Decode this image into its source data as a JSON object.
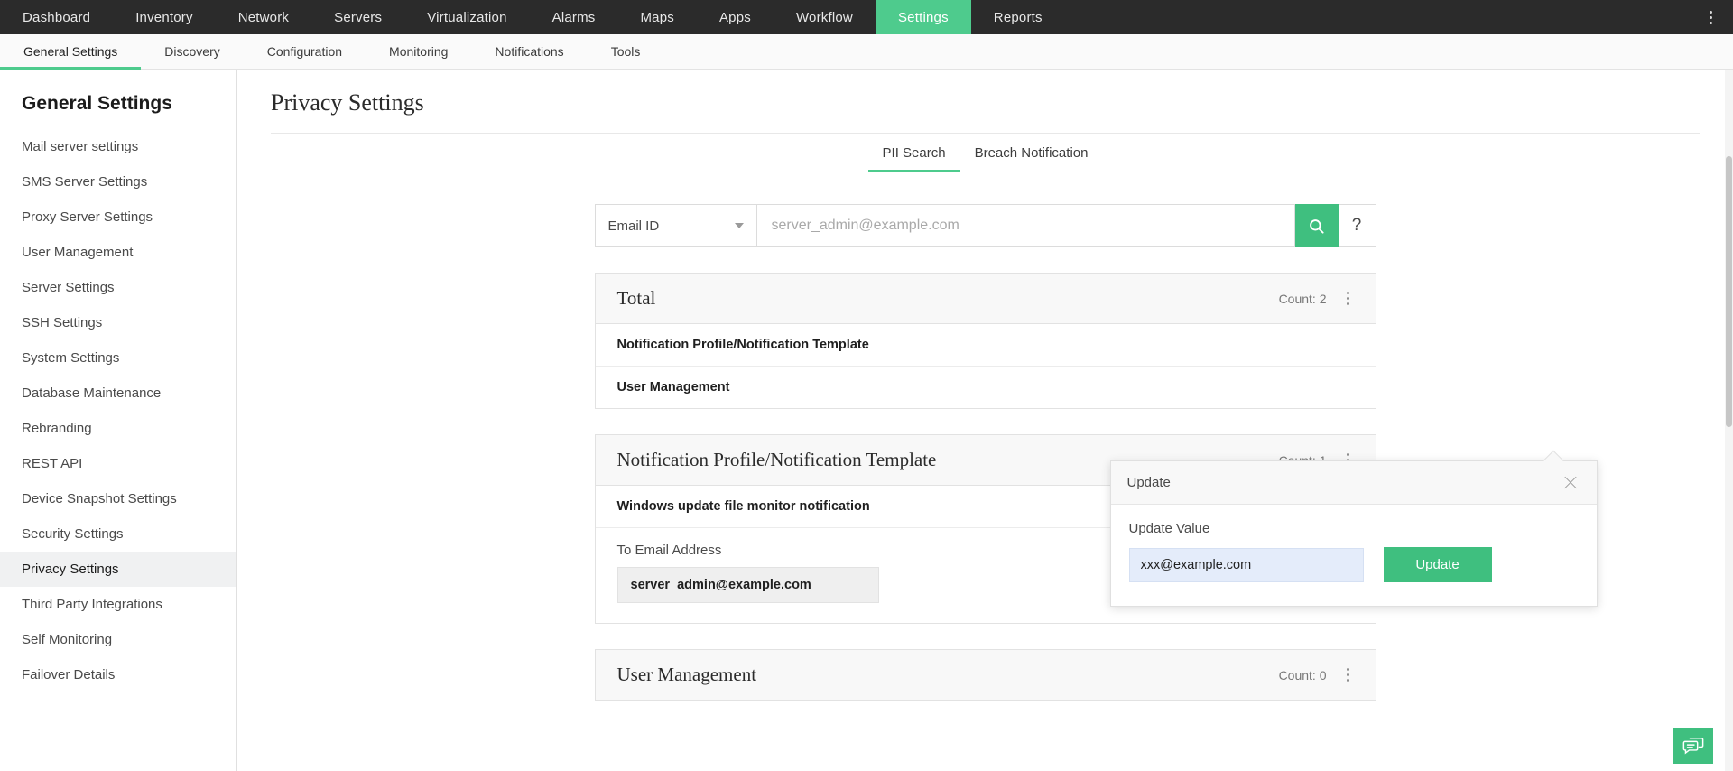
{
  "topnav": {
    "items": [
      {
        "label": "Dashboard",
        "active": false
      },
      {
        "label": "Inventory",
        "active": false
      },
      {
        "label": "Network",
        "active": false
      },
      {
        "label": "Servers",
        "active": false
      },
      {
        "label": "Virtualization",
        "active": false
      },
      {
        "label": "Alarms",
        "active": false
      },
      {
        "label": "Maps",
        "active": false
      },
      {
        "label": "Apps",
        "active": false
      },
      {
        "label": "Workflow",
        "active": false
      },
      {
        "label": "Settings",
        "active": true
      },
      {
        "label": "Reports",
        "active": false
      }
    ],
    "overflow_icon": "kebab-vertical-icon"
  },
  "subnav": {
    "items": [
      {
        "label": "General Settings",
        "active": true
      },
      {
        "label": "Discovery",
        "active": false
      },
      {
        "label": "Configuration",
        "active": false
      },
      {
        "label": "Monitoring",
        "active": false
      },
      {
        "label": "Notifications",
        "active": false
      },
      {
        "label": "Tools",
        "active": false
      }
    ]
  },
  "sidebar": {
    "title": "General Settings",
    "items": [
      {
        "label": "Mail server settings",
        "active": false
      },
      {
        "label": "SMS Server Settings",
        "active": false
      },
      {
        "label": "Proxy Server Settings",
        "active": false
      },
      {
        "label": "User Management",
        "active": false
      },
      {
        "label": "Server Settings",
        "active": false
      },
      {
        "label": "SSH Settings",
        "active": false
      },
      {
        "label": "System Settings",
        "active": false
      },
      {
        "label": "Database Maintenance",
        "active": false
      },
      {
        "label": "Rebranding",
        "active": false
      },
      {
        "label": "REST API",
        "active": false
      },
      {
        "label": "Device Snapshot Settings",
        "active": false
      },
      {
        "label": "Security Settings",
        "active": false
      },
      {
        "label": "Privacy Settings",
        "active": true
      },
      {
        "label": "Third Party Integrations",
        "active": false
      },
      {
        "label": "Self Monitoring",
        "active": false
      },
      {
        "label": "Failover Details",
        "active": false
      }
    ]
  },
  "main": {
    "page_title": "Privacy Settings",
    "tabs": [
      {
        "label": "PII Search",
        "active": true
      },
      {
        "label": "Breach Notification",
        "active": false
      }
    ],
    "search": {
      "select_value": "Email ID",
      "select_icon": "chevron-down-icon",
      "input_value": "",
      "placeholder": "server_admin@example.com",
      "search_icon": "search-icon",
      "help_label": "?"
    },
    "cards": [
      {
        "title": "Total",
        "count_label": "Count: 2",
        "menu_icon": "kebab-vertical-icon",
        "rows": [
          "Notification Profile/Notification Template",
          "User Management"
        ]
      },
      {
        "title": "Notification Profile/Notification Template",
        "count_label": "Count: 1",
        "menu_icon": "kebab-vertical-icon",
        "rows": [
          "Windows update file monitor notification"
        ],
        "detail": {
          "label": "To Email Address",
          "value": "server_admin@example.com"
        }
      },
      {
        "title": "User Management",
        "count_label": "Count: 0",
        "menu_icon": "kebab-vertical-icon",
        "rows": []
      }
    ],
    "popover": {
      "title": "Update",
      "close_icon": "close-icon",
      "field_label": "Update Value",
      "input_value": "xxx@example.com",
      "button_label": "Update"
    }
  },
  "fab": {
    "icon": "chat-bubbles-icon"
  },
  "colors": {
    "accent_green": "#4ecb8d",
    "button_green": "#3fbf7f",
    "topnav_dark": "#2b2b2b",
    "sidebar_active": "#f0f1f2",
    "input_focus_blue": "#e4ecfa"
  }
}
